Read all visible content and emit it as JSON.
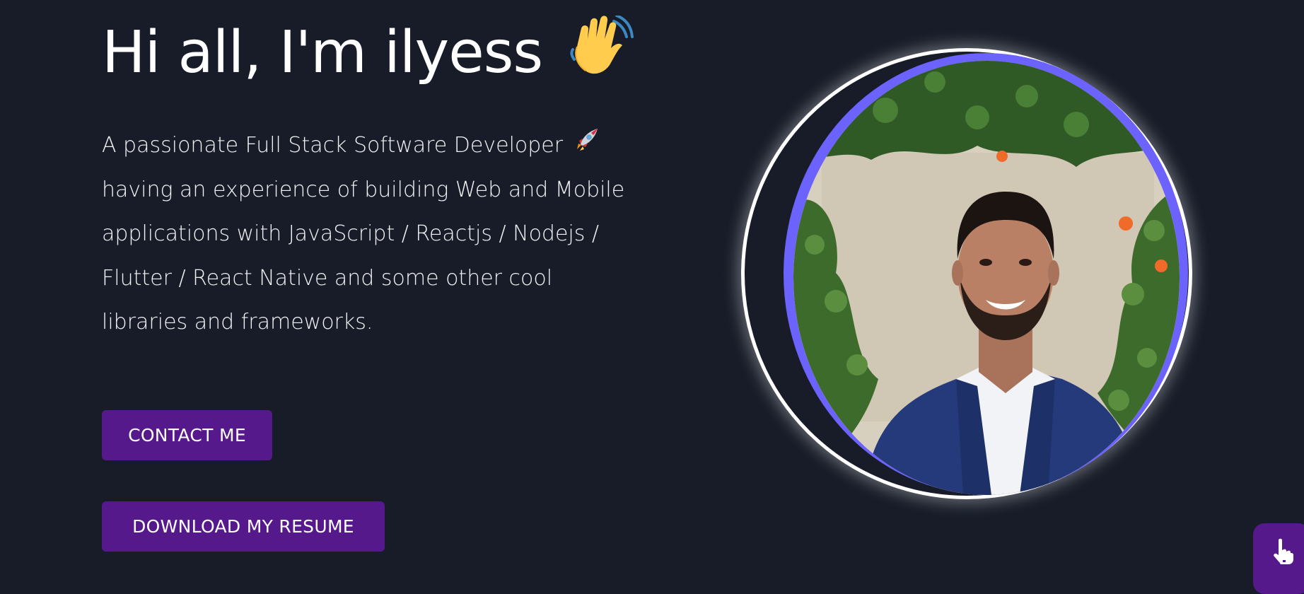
{
  "hero": {
    "greeting": "Hi all, I'm ilyess",
    "wave_icon": "waving-hand-icon",
    "intro_lines": [
      "A passionate Full Stack Software Developer",
      "having an experience of building Web and Mobile",
      "applications with JavaScript / Reactjs / Nodejs /",
      "Flutter / React Native and some other cool",
      "libraries and frameworks."
    ],
    "rocket_icon": "rocket-icon",
    "contact_label": "CONTACT ME",
    "resume_label": "DOWNLOAD MY RESUME"
  },
  "profile": {
    "photo_icon": "profile-photo"
  },
  "fab": {
    "icon": "pointing-hand-icon"
  },
  "colors": {
    "background": "#171c28",
    "button": "#55198b",
    "ring": "#6c63ff",
    "text": "#ffffff"
  }
}
